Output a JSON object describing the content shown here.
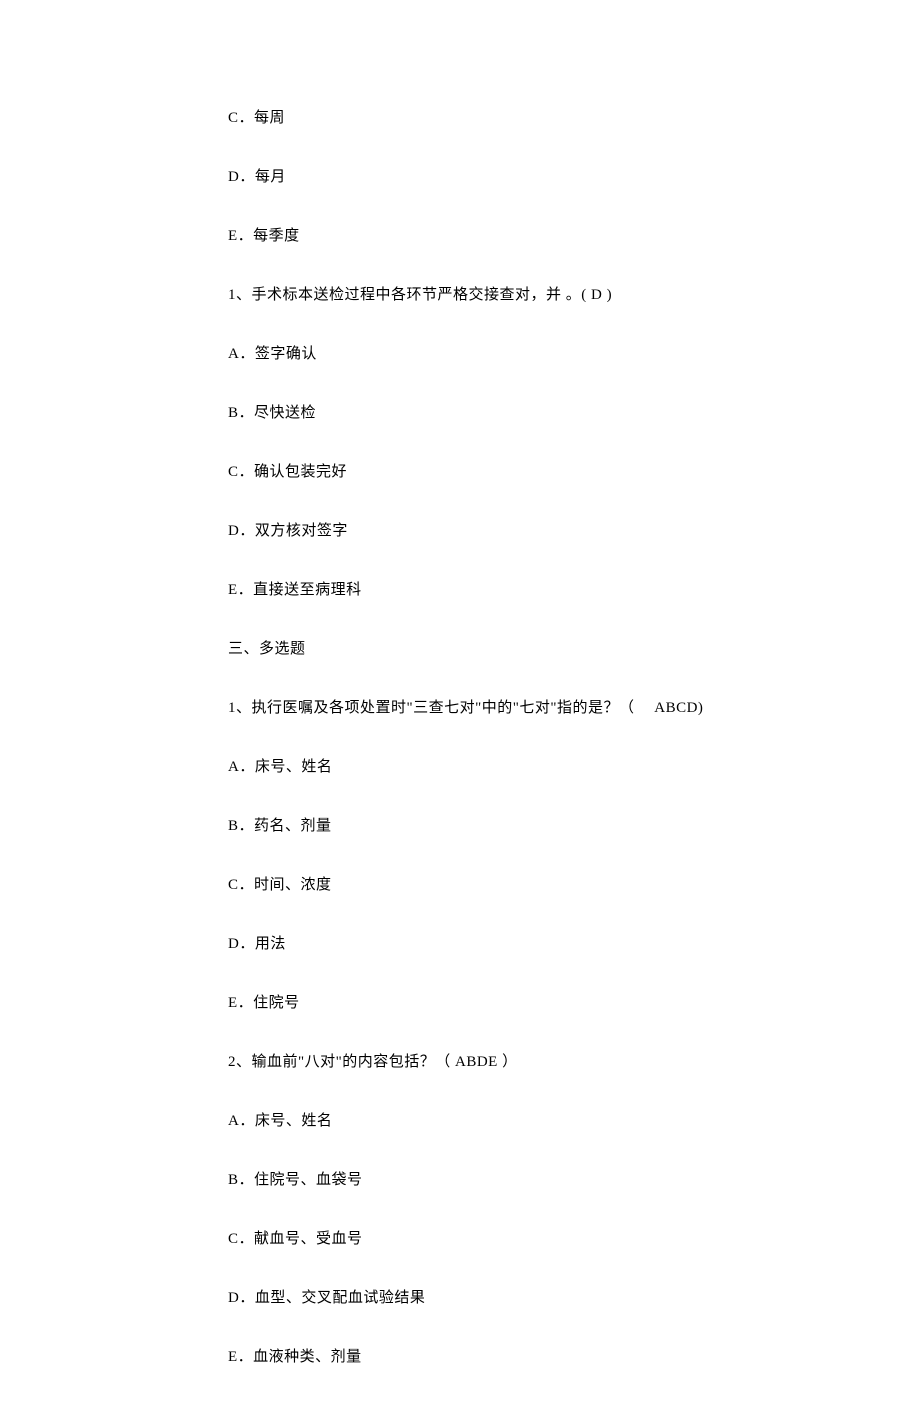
{
  "lines": {
    "l1": "C．每周",
    "l2": "D．每月",
    "l3": "E．每季度",
    "l4": "1、手术标本送检过程中各环节严格交接查对，并 。( D )",
    "l5": "A．签字确认",
    "l6": "B．尽快送检",
    "l7": "C．确认包装完好",
    "l8": "D．双方核对签字",
    "l9": "E．直接送至病理科",
    "l10": "三、多选题",
    "l11": "1、执行医嘱及各项处置时\"三查七对\"中的\"七对\"指的是？（　 ABCD)",
    "l12": "A．床号、姓名",
    "l13": "B．药名、剂量",
    "l14": "C．时间、浓度",
    "l15": "D．用法",
    "l16": "E．住院号",
    "l17": "2、输血前\"八对\"的内容包括？（ ABDE ）",
    "l18": "A．床号、姓名",
    "l19": "B．住院号、血袋号",
    "l20": "C．献血号、受血号",
    "l21": "D．血型、交叉配血试验结果",
    "l22": "E．血液种类、剂量"
  }
}
